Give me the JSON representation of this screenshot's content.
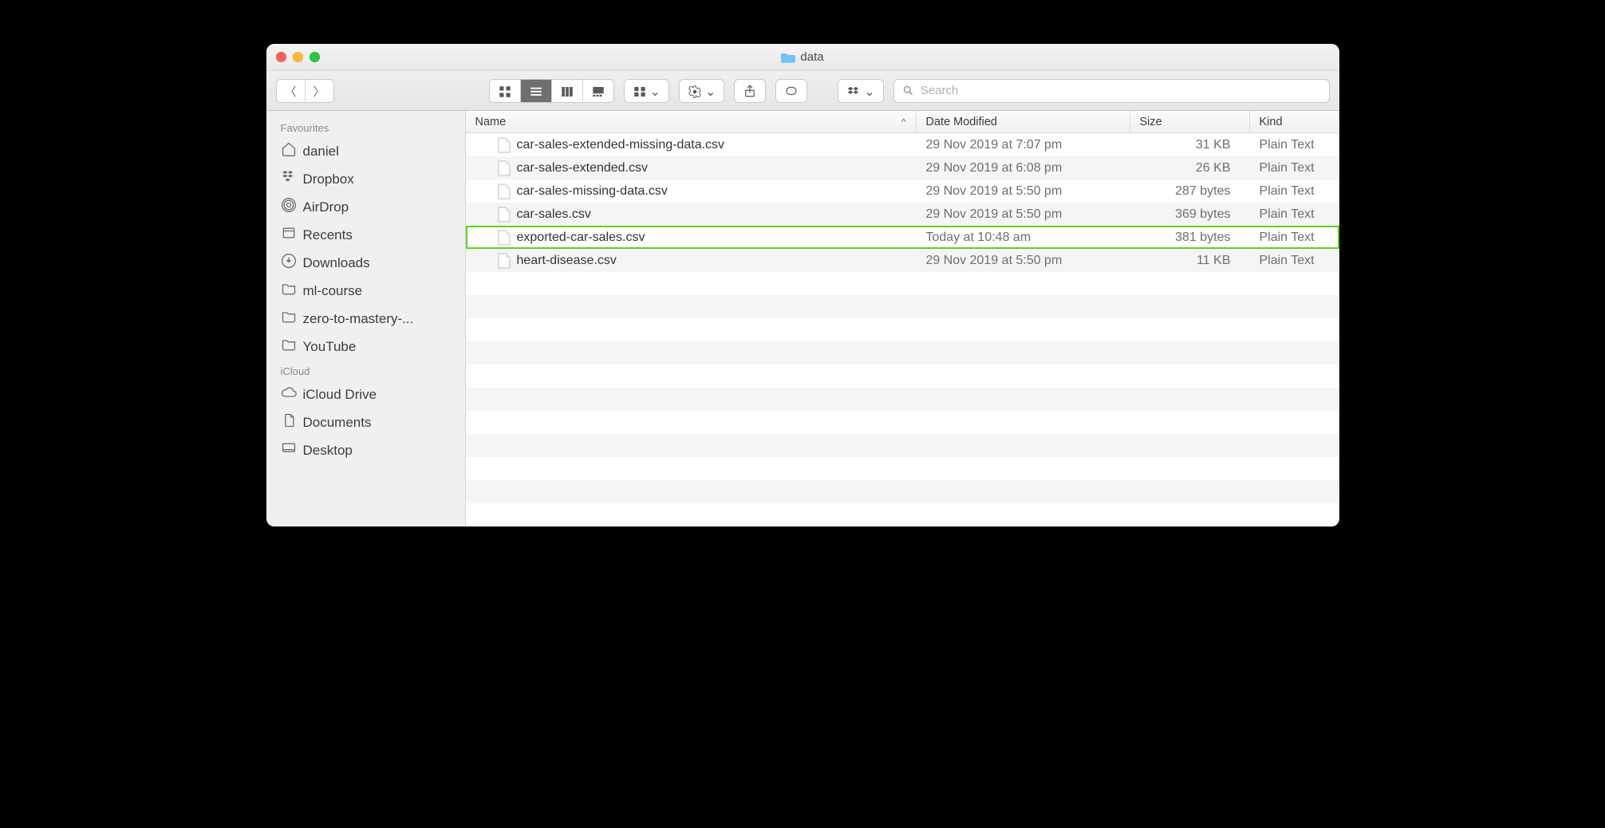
{
  "window": {
    "title": "data"
  },
  "search": {
    "placeholder": "Search"
  },
  "sidebar": {
    "sections": [
      {
        "header": "Favourites",
        "items": [
          {
            "icon": "home",
            "label": "daniel"
          },
          {
            "icon": "dropbox",
            "label": "Dropbox"
          },
          {
            "icon": "airdrop",
            "label": "AirDrop"
          },
          {
            "icon": "recents",
            "label": "Recents"
          },
          {
            "icon": "downloads",
            "label": "Downloads"
          },
          {
            "icon": "folder",
            "label": "ml-course"
          },
          {
            "icon": "folder",
            "label": "zero-to-mastery-..."
          },
          {
            "icon": "folder",
            "label": "YouTube"
          }
        ]
      },
      {
        "header": "iCloud",
        "items": [
          {
            "icon": "cloud",
            "label": "iCloud Drive"
          },
          {
            "icon": "documents",
            "label": "Documents"
          },
          {
            "icon": "desktop",
            "label": "Desktop"
          }
        ]
      }
    ]
  },
  "columns": {
    "name": "Name",
    "date": "Date Modified",
    "size": "Size",
    "kind": "Kind",
    "sort_indicator": "^"
  },
  "files": [
    {
      "name": "car-sales-extended-missing-data.csv",
      "date": "29 Nov 2019 at 7:07 pm",
      "size": "31 KB",
      "kind": "Plain Text",
      "highlight": false
    },
    {
      "name": "car-sales-extended.csv",
      "date": "29 Nov 2019 at 6:08 pm",
      "size": "26 KB",
      "kind": "Plain Text",
      "highlight": false
    },
    {
      "name": "car-sales-missing-data.csv",
      "date": "29 Nov 2019 at 5:50 pm",
      "size": "287 bytes",
      "kind": "Plain Text",
      "highlight": false
    },
    {
      "name": "car-sales.csv",
      "date": "29 Nov 2019 at 5:50 pm",
      "size": "369 bytes",
      "kind": "Plain Text",
      "highlight": false
    },
    {
      "name": "exported-car-sales.csv",
      "date": "Today at 10:48 am",
      "size": "381 bytes",
      "kind": "Plain Text",
      "highlight": true
    },
    {
      "name": "heart-disease.csv",
      "date": "29 Nov 2019 at 5:50 pm",
      "size": "11 KB",
      "kind": "Plain Text",
      "highlight": false
    }
  ]
}
